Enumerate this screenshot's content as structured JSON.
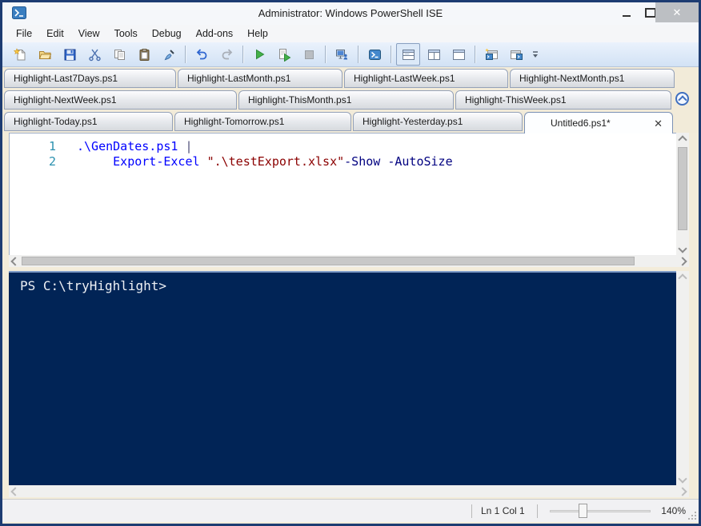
{
  "window": {
    "title": "Administrator: Windows PowerShell ISE",
    "close_glyph": "✕"
  },
  "menu": {
    "items": [
      "File",
      "Edit",
      "View",
      "Tools",
      "Debug",
      "Add-ons",
      "Help"
    ]
  },
  "toolbar": {
    "icons": [
      "new-script",
      "open-script",
      "save-script",
      "cut",
      "copy",
      "paste",
      "clear-console-pane",
      "undo",
      "redo",
      "run-script",
      "run-selection",
      "stop-operation",
      "new-remote-powershell-tab",
      "start-powershell-exe",
      "show-script-pane-top",
      "show-script-pane-right",
      "show-script-pane-maximized",
      "new-powershell-tab",
      "show-command-window",
      "toolbar-overflow"
    ],
    "selected": "show-script-pane-top"
  },
  "tabs": {
    "row1": [
      "Highlight-Last7Days.ps1",
      "Highlight-LastMonth.ps1",
      "Highlight-LastWeek.ps1",
      "Highlight-NextMonth.ps1"
    ],
    "row2": [
      "Highlight-NextWeek.ps1",
      "Highlight-ThisMonth.ps1",
      "Highlight-ThisWeek.ps1"
    ],
    "row3": [
      "Highlight-Today.ps1",
      "Highlight-Tomorrow.ps1",
      "Highlight-Yesterday.ps1"
    ],
    "active": "Untitled6.ps1*",
    "close_glyph": "✕"
  },
  "editor": {
    "lines": [
      {
        "number": "1",
        "segments": [
          {
            "text": ".\\GenDates.ps1 ",
            "type": "command"
          },
          {
            "text": "|",
            "type": "operator"
          }
        ]
      },
      {
        "number": "2",
        "segments": [
          {
            "text": "     ",
            "type": "plain"
          },
          {
            "text": "Export-Excel ",
            "type": "command"
          },
          {
            "text": "\".\\testExport.xlsx\"",
            "type": "string"
          },
          {
            "text": "-Show -AutoSize",
            "type": "parameter"
          }
        ]
      }
    ]
  },
  "console": {
    "prompt": "PS C:\\tryHighlight>"
  },
  "statusbar": {
    "line_col": "Ln 1 Col 1",
    "zoom": "140%"
  },
  "colors": {
    "console_bg": "#012456",
    "console_text": "#EEF0F4",
    "code_command": "#0000FF",
    "code_string": "#8B0000",
    "code_parameter": "#000080",
    "code_operator": "#505078",
    "line_number": "#2B91AF",
    "run_button_green": "#43B049",
    "window_border": "#1D3C72"
  }
}
